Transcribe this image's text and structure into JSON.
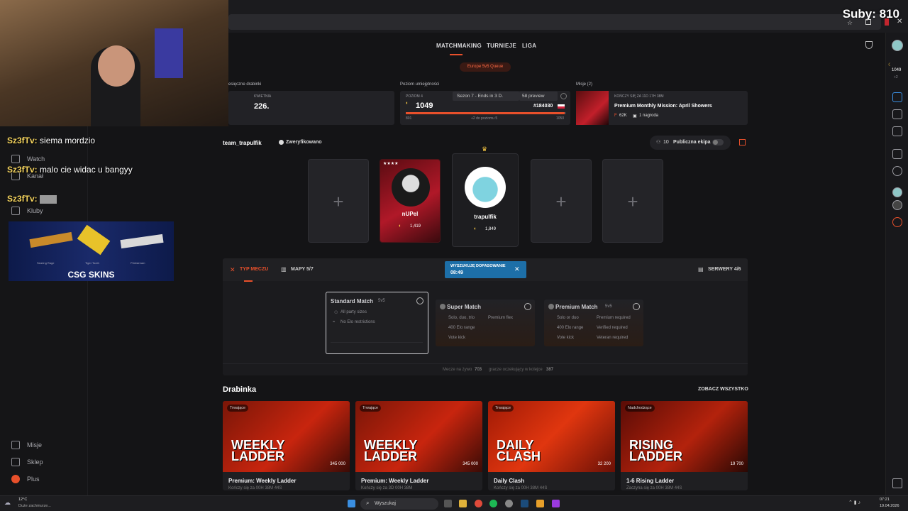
{
  "stream": {
    "subs_label": "Suby: 810"
  },
  "nav": {
    "matchmaking": "MATCHMAKING",
    "tournaments": "TURNIEJE",
    "league": "LIGA",
    "queue_badge": "Europe 5v5 Queue"
  },
  "cards": {
    "ladders": {
      "label": "esięczne drabinki",
      "sub": "KWIETNIA",
      "value": "226."
    },
    "skill": {
      "label": "Poziom umiejętności",
      "level": "POZIOM 4",
      "elo": "1049",
      "season": "Sezon 7 - Ends in 3 D.",
      "preview": "58 preview",
      "rank": "#184030",
      "min": "801",
      "note": "+2 do poziomu 5",
      "max": "1050"
    },
    "missions": {
      "label": "Misje (2)",
      "ends": "KOŃCZY SIĘ ZA 11D 17H 38M",
      "title": "Premium Monthly Mission: April Showers",
      "reward_pts": "62K",
      "reward_count": "1 nagroda"
    }
  },
  "party": {
    "team_name": "team_trapulfik",
    "verified": "Zweryfikowano",
    "public_count": "10",
    "public_label": "Publiczna ekipa",
    "players": [
      {
        "name": "nUPel",
        "elo": "1,419"
      },
      {
        "name": "trapulfik",
        "elo": "1,849"
      }
    ]
  },
  "panel": {
    "tab_type": "TYP MECZU",
    "tab_maps": "MAPY 5/7",
    "searching": "WYSZUKUJĘ DOPASOWANIE",
    "timer": "08:49",
    "servers": "SERWERY 4/6",
    "standard": {
      "title": "Standard Match",
      "mode": "5v5",
      "f1": "All party sizes",
      "f2": "No Elo restrictions"
    },
    "super": {
      "title": "Super Match",
      "f1": "Solo, duo, trio",
      "f2": "Premium flex",
      "f3": "400 Elo range",
      "f4": "Vote kick"
    },
    "premium": {
      "title": "Premium Match",
      "mode": "5v5",
      "f1": "Solo or duo",
      "f2": "Premium required",
      "f3": "400 Elo range",
      "f4": "Verified required",
      "f5": "Vote kick",
      "f6": "Veteran required"
    },
    "footer_live_label": "Mecze na żywo",
    "footer_live": "703",
    "footer_queue_label": "gracze oczekujący w kolejce",
    "footer_queue": "387"
  },
  "ladder": {
    "title": "Drabinka",
    "see_all": "ZOBACZ WSZYSTKO",
    "items": [
      {
        "badge": "Trwające",
        "big1": "WEEKLY",
        "big2": "LADDER",
        "pool": "345 000",
        "name": "Premium: Weekly Ladder",
        "sub": "Kończy się za 00H 38M 44S"
      },
      {
        "badge": "Trwające",
        "big1": "WEEKLY",
        "big2": "LADDER",
        "pool": "345 000",
        "name": "Premium: Weekly Ladder",
        "sub": "Kończy się za 3D 00H 38M"
      },
      {
        "badge": "Trwające",
        "big1": "DAILY",
        "big2": "CLASH",
        "pool": "32 200",
        "name": "Daily Clash",
        "sub": "Kończy się za 00H 38M 44S"
      },
      {
        "badge": "Nadchodzące",
        "big1": "RISING",
        "big2": "LADDER",
        "pool": "19 700",
        "name": "1-6 Rising Ladder",
        "sub": "Zaczyna się za 00H 38M 44S"
      }
    ]
  },
  "sidebar": {
    "watch": "Watch",
    "kanal": "Kanał",
    "kluby": "Kluby",
    "misje": "Misje",
    "sklep": "Sklep",
    "plus": "Plus"
  },
  "rail": {
    "elo": "1049",
    "elo_delta": "+2"
  },
  "chat": [
    {
      "user": "Sz3fTv:",
      "msg": "siema mordzio"
    },
    {
      "user": "Sz3fTv:",
      "msg": "malo cie widac u bangyy"
    },
    {
      "user": "Sz3fTv:",
      "msg": ""
    }
  ],
  "ad": {
    "brand": "CSG SKINS",
    "items": [
      "Searing Rage",
      "Tiger Tooth",
      "Printstream"
    ]
  },
  "taskbar": {
    "temp": "12°C",
    "weather": "Duże zachmurze...",
    "search": "Wyszukaj",
    "time": "07:21",
    "date": "19.04.2026"
  },
  "colors": {
    "accent": "#e8502b",
    "bg": "#141416",
    "card": "#222226",
    "search_blue": "#1d6fa8"
  }
}
